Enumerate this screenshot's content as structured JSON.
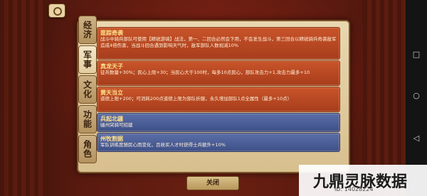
{
  "tabs": [
    "经济",
    "军事",
    "文化",
    "功能",
    "角色"
  ],
  "active_tab": "军事",
  "cards": [
    {
      "title": "匪踪奇袭",
      "desc": "战斗中骑兵部队可使用【精锐游骑】战法，第一、二回合必然会下用，不会发生战斗，第三回合以精锐骑兵奇袭敌军造成4倍伤害，当战斗回合遇到影响天气时，敌军部队人数视减10%",
      "style": "orange"
    },
    {
      "title": "真龙天子",
      "desc": "征兵数量+30%；民心上限+30；当民心大于100时，每多10点民心，部队攻击力+1,攻击力最多+10",
      "style": "orange"
    },
    {
      "title": "黄天当立",
      "desc": "道德上限+200；可消耗200点道德上限为部队折服，永久增加部队1点全属性（最多+10点）",
      "style": "orange"
    },
    {
      "title": "兵起北疆",
      "desc": "幽州突骑可招建",
      "style": "blue"
    },
    {
      "title": "州牧割据",
      "desc": "军队训练度随民心而变化，且收买人才时获得士兵额外+10%",
      "style": "blue"
    }
  ],
  "close_label": "关闭",
  "watermark": "九鼎灵脉数据",
  "id_tag": "ID: 14028224"
}
